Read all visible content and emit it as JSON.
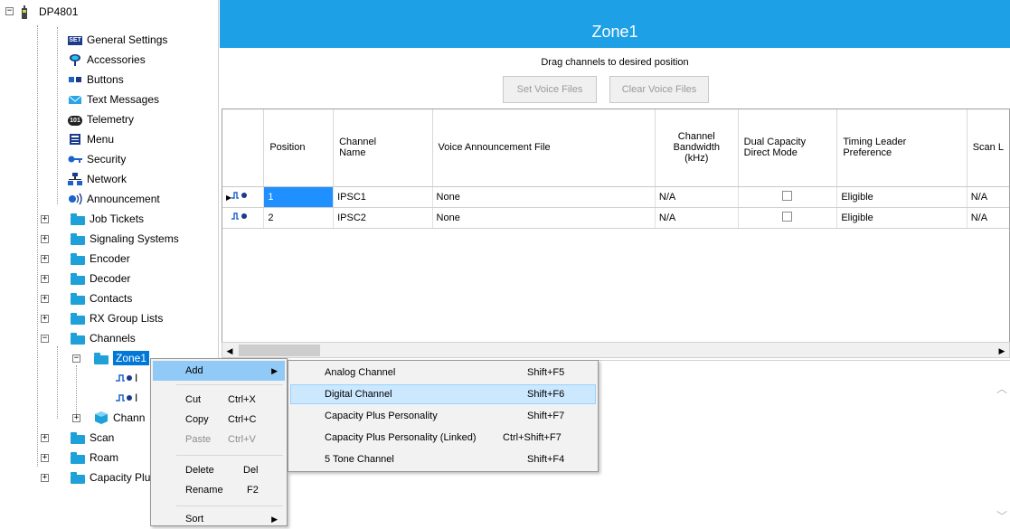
{
  "tree": {
    "root": "DP4801",
    "items": {
      "general": "General Settings",
      "accessories": "Accessories",
      "buttons": "Buttons",
      "text": "Text Messages",
      "telemetry": "Telemetry",
      "menu": "Menu",
      "security": "Security",
      "network": "Network",
      "announcement": "Announcement",
      "job": "Job Tickets",
      "signaling": "Signaling Systems",
      "encoder": "Encoder",
      "decoder": "Decoder",
      "contacts": "Contacts",
      "rx": "RX Group Lists",
      "channels": "Channels",
      "zone1": "Zone1",
      "zone_child1": "I",
      "zone_child2": "I",
      "chann": "Chann",
      "scan": "Scan",
      "roam": "Roam",
      "capplus": "Capacity Plu"
    },
    "icon_text": {
      "set": "SET",
      "telemetry": "101"
    }
  },
  "header": {
    "title": "Zone1"
  },
  "instructions": "Drag channels to desired position",
  "buttons": {
    "set_voice": "Set Voice Files",
    "clear_voice": "Clear Voice Files"
  },
  "grid": {
    "columns": {
      "position": "Position",
      "name": "Channel\nName",
      "voice": "Voice Announcement File",
      "bandwidth": "Channel\nBandwidth\n(kHz)",
      "dual": "Dual Capacity\nDirect Mode",
      "timing": "Timing Leader\nPreference",
      "scan": "Scan L"
    },
    "rows": [
      {
        "position": "1",
        "name": "IPSC1",
        "voice": "None",
        "bandwidth": "N/A",
        "timing": "Eligible",
        "scan": "N/A",
        "dual_checked": false
      },
      {
        "position": "2",
        "name": "IPSC2",
        "voice": "None",
        "bandwidth": "N/A",
        "timing": "Eligible",
        "scan": "N/A",
        "dual_checked": false
      }
    ]
  },
  "context_menu": {
    "add": "Add",
    "cut": "Cut",
    "cut_sc": "Ctrl+X",
    "copy": "Copy",
    "copy_sc": "Ctrl+C",
    "paste": "Paste",
    "paste_sc": "Ctrl+V",
    "delete": "Delete",
    "delete_sc": "Del",
    "rename": "Rename",
    "rename_sc": "F2",
    "sort": "Sort"
  },
  "submenu": {
    "analog": "Analog Channel",
    "analog_sc": "Shift+F5",
    "digital": "Digital Channel",
    "digital_sc": "Shift+F6",
    "capplus": "Capacity Plus Personality",
    "capplus_sc": "Shift+F7",
    "capplus_linked": "Capacity Plus Personality (Linked)",
    "capplus_linked_sc": "Ctrl+Shift+F7",
    "fivetone": "5 Tone Channel",
    "fivetone_sc": "Shift+F4"
  },
  "colors": {
    "accent": "#1ea0e6",
    "selection": "#1e90ff",
    "menu_highlight": "#91c9f7"
  },
  "icons": [
    "radio-icon",
    "set-icon",
    "microphone-icon",
    "buttons-icon",
    "envelope-icon",
    "telemetry-icon",
    "menu-icon",
    "key-icon",
    "network-icon",
    "speaker-icon",
    "folder-icon",
    "channel-icon",
    "cube-icon"
  ]
}
